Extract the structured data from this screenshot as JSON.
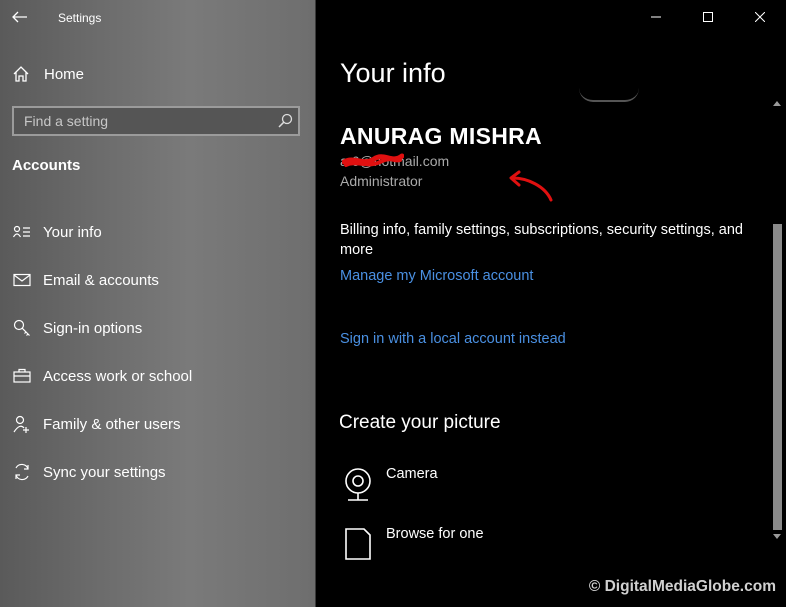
{
  "window": {
    "title": "Settings"
  },
  "sidebar": {
    "home_label": "Home",
    "search_placeholder": "Find a setting",
    "section_title": "Accounts",
    "items": [
      {
        "label": "Your info",
        "icon": "contact-card-icon"
      },
      {
        "label": "Email & accounts",
        "icon": "envelope-icon"
      },
      {
        "label": "Sign-in options",
        "icon": "key-icon"
      },
      {
        "label": "Access work or school",
        "icon": "briefcase-icon"
      },
      {
        "label": "Family & other users",
        "icon": "person-add-icon"
      },
      {
        "label": "Sync your settings",
        "icon": "sync-icon"
      }
    ]
  },
  "main": {
    "page_title": "Your info",
    "user": {
      "name": "ANURAG MISHRA",
      "email": "a         6@hotmail.com",
      "role": "Administrator"
    },
    "billing_text": "Billing info, family settings, subscriptions, security settings, and more",
    "manage_link": "Manage my Microsoft account",
    "local_link": "Sign in with a local account instead",
    "picture_section_title": "Create your picture",
    "picture_options": [
      {
        "label": "Camera",
        "icon": "webcam-icon"
      },
      {
        "label": "Browse for one",
        "icon": "document-icon"
      }
    ]
  },
  "watermark": "© DigitalMediaGlobe.com",
  "colors": {
    "link": "#4a90e2",
    "annotation_red": "#e01010"
  }
}
